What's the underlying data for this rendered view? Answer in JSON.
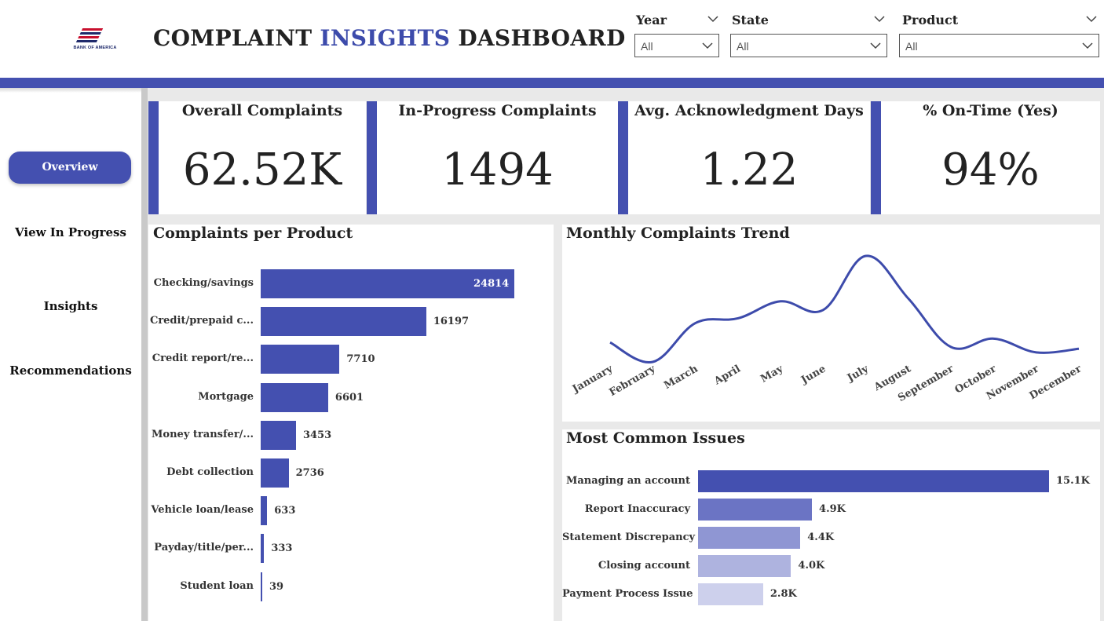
{
  "brand": {
    "logo_text": "BANK OF AMERICA",
    "accent": "#4450b0",
    "logo_red": "#c8102e",
    "logo_blue": "#1f2a6b"
  },
  "header": {
    "title_part1": "COMPLAINT ",
    "title_accent": "INSIGHTS",
    "title_part2": " DASHBOARD"
  },
  "filters": [
    {
      "label": "Year",
      "value": "All"
    },
    {
      "label": "State",
      "value": "All"
    },
    {
      "label": "Product",
      "value": "All"
    }
  ],
  "nav": {
    "items": [
      "Overview",
      "View In Progress",
      "Insights",
      "Recommendations"
    ],
    "active": "Overview"
  },
  "kpis": [
    {
      "title": "Overall Complaints",
      "value": "62.52K"
    },
    {
      "title": "In-Progress Complaints",
      "value": "1494"
    },
    {
      "title": "Avg. Acknowledgment Days",
      "value": "1.22"
    },
    {
      "title": "% On-Time (Yes)",
      "value": "94%"
    }
  ],
  "chart_data": [
    {
      "type": "bar",
      "orientation": "horizontal",
      "title": "Complaints per Product",
      "categories": [
        "Checking/savings",
        "Credit/prepaid c...",
        "Credit report/re...",
        "Mortgage",
        "Money transfer/...",
        "Debt collection",
        "Vehicle loan/lease",
        "Payday/title/per...",
        "Student loan"
      ],
      "values": [
        24814,
        16197,
        7710,
        6601,
        3453,
        2736,
        633,
        333,
        39
      ],
      "labels": [
        "24814",
        "16197",
        "7710",
        "6601",
        "3453",
        "2736",
        "633",
        "333",
        "39"
      ],
      "color": "#4450b0"
    },
    {
      "type": "line",
      "title": "Monthly Complaints Trend",
      "categories": [
        "January",
        "February",
        "March",
        "April",
        "May",
        "June",
        "July",
        "August",
        "September",
        "October",
        "November",
        "December"
      ],
      "values": [
        4990,
        4340,
        5640,
        5800,
        6370,
        6080,
        7890,
        6460,
        4840,
        5120,
        4660,
        4780
      ],
      "color": "#3d4bab"
    },
    {
      "type": "bar",
      "orientation": "horizontal",
      "title": "Most Common Issues",
      "categories": [
        "Managing an account",
        "Report Inaccuracy",
        "Statement Discrepancy",
        "Closing account",
        "Payment Process Issue"
      ],
      "values": [
        15.1,
        4.9,
        4.4,
        4.0,
        2.8
      ],
      "labels": [
        "15.1K",
        "4.9K",
        "4.4K",
        "4.0K",
        "2.8K"
      ],
      "colors": [
        "#4450b0",
        "#6b74c4",
        "#8f96d3",
        "#aeb3df",
        "#cdd0ec"
      ]
    }
  ]
}
